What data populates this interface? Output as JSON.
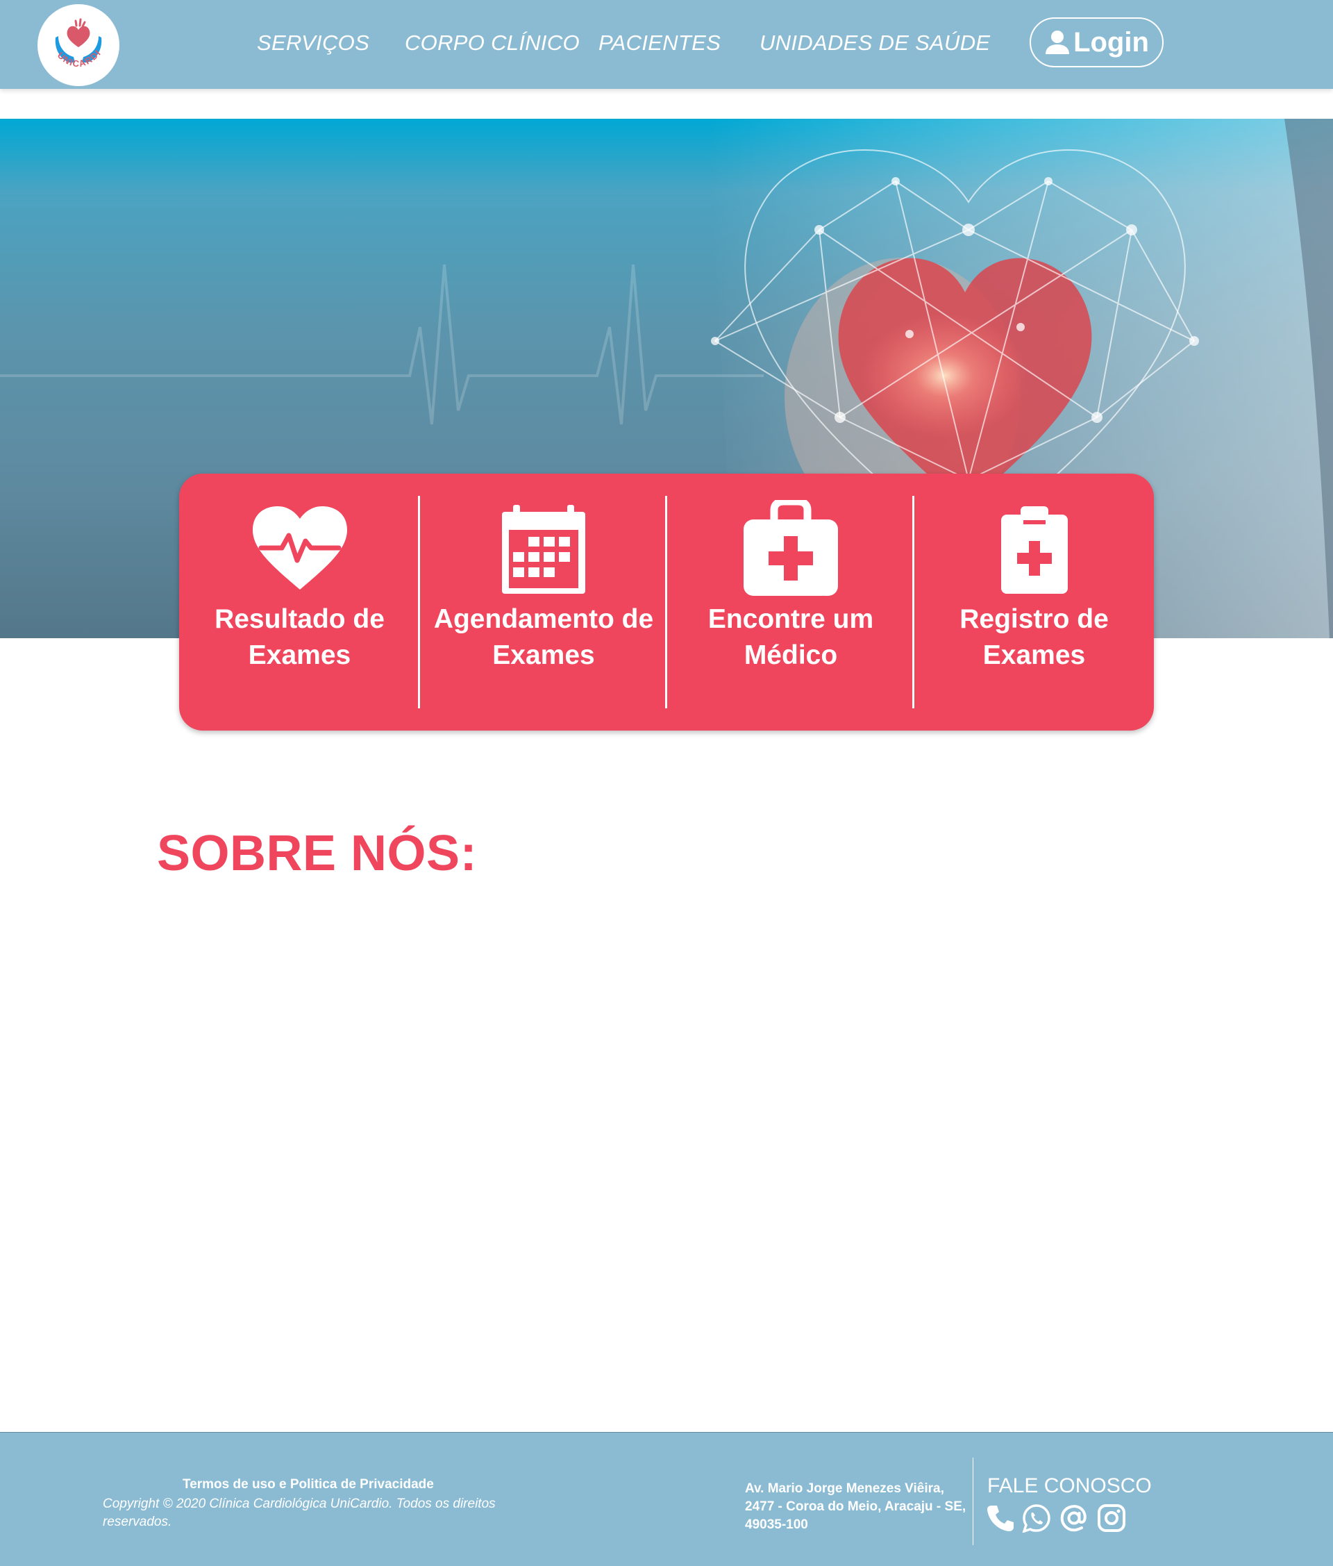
{
  "header": {
    "logo_text": "UNICARDIO",
    "nav": [
      "SERVIÇOS",
      "CORPO CLÍNICO",
      "PACIENTES",
      "UNIDADES DE SAÚDE"
    ],
    "login_label": "Login"
  },
  "cards": [
    {
      "label": "Resultado de Exames",
      "icon": "heart-pulse-icon"
    },
    {
      "label": "Agendamento de Exames",
      "icon": "calendar-icon"
    },
    {
      "label": "Encontre um Médico",
      "icon": "medical-kit-icon"
    },
    {
      "label": "Registro de Exames",
      "icon": "medical-clipboard-icon"
    }
  ],
  "about": {
    "title": "SOBRE NÓS:"
  },
  "footer": {
    "terms": "Termos de uso e Politica de Privacidade",
    "copyright": "Copyright © 2020 Clínica Cardiológica UniCardio. Todos os direitos reservados.",
    "address": "Av. Mario Jorge Menezes Viêira, 2477 - Coroa do Meio, Aracaju - SE, 49035-100",
    "contact_title": "FALE CONOSCO",
    "social_icons": [
      "phone-icon",
      "whatsapp-icon",
      "email-at-icon",
      "instagram-icon"
    ]
  },
  "colors": {
    "header_bg": "#8bbbd3",
    "accent_red": "#f0465d",
    "white": "#ffffff"
  }
}
